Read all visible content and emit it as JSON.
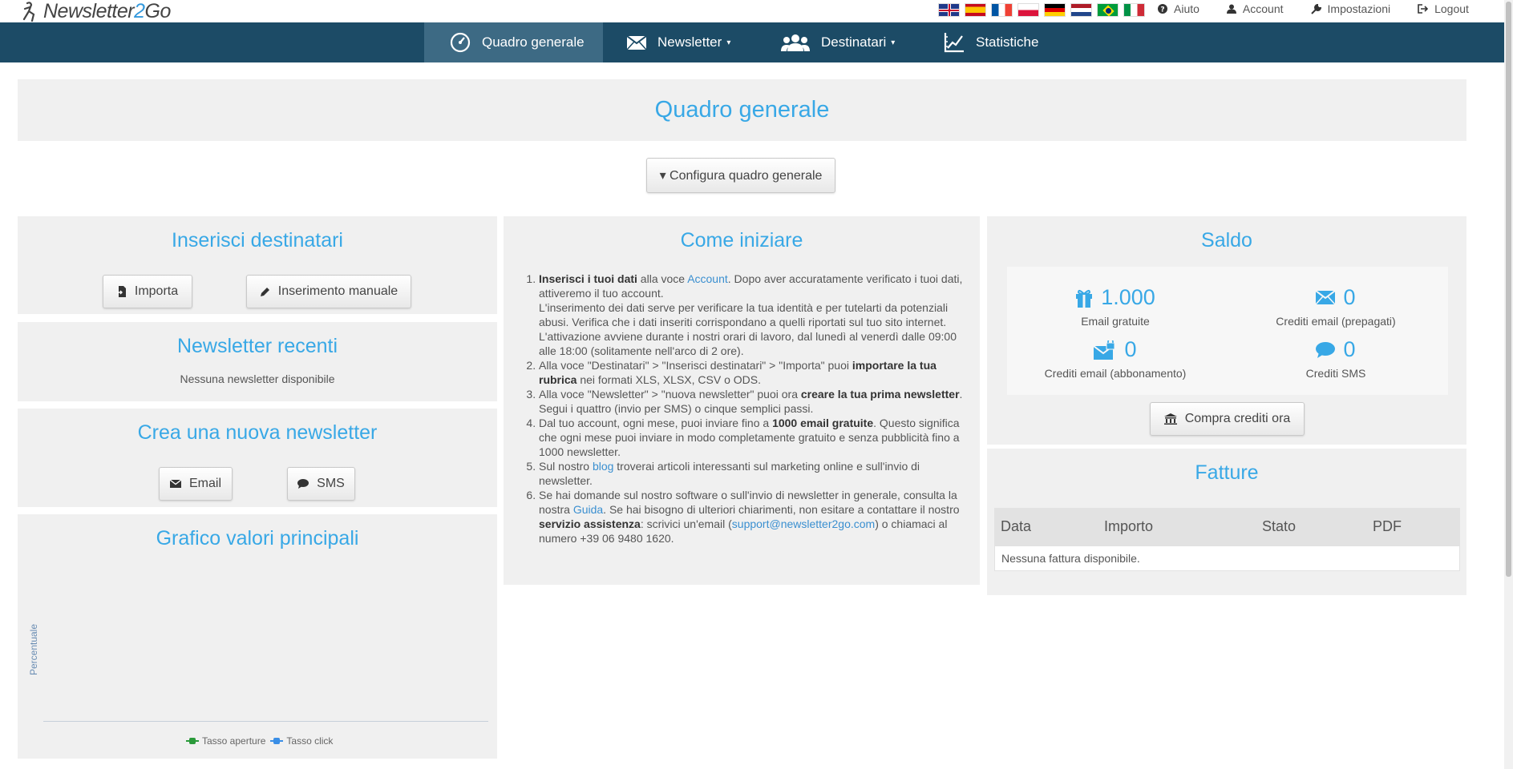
{
  "brand": {
    "name_part1": "Newsletter",
    "name_part2": "2",
    "name_part3": "Go"
  },
  "flags": [
    "flag-uk",
    "flag-spain",
    "flag-france",
    "flag-poland",
    "flag-germany",
    "flag-netherlands",
    "flag-brazil",
    "flag-italy"
  ],
  "toplinks": {
    "help": "Aiuto",
    "account": "Account",
    "settings": "Impostazioni",
    "logout": "Logout"
  },
  "nav": {
    "overview": "Quadro generale",
    "newsletter": "Newsletter",
    "recipients": "Destinatari",
    "stats": "Statistiche",
    "caret": "▾"
  },
  "page": {
    "title": "Quadro generale",
    "configure_button": "▾ Configura quadro generale"
  },
  "insert_recipients": {
    "title": "Inserisci destinatari",
    "import": "Importa",
    "manual": "Inserimento manuale"
  },
  "recent_newsletters": {
    "title": "Newsletter recenti",
    "empty": "Nessuna newsletter disponibile"
  },
  "create_newsletter": {
    "title": "Crea una nuova newsletter",
    "email": "Email",
    "sms": "SMS"
  },
  "chart": {
    "title": "Grafico valori principali",
    "ylabel": "Percentuale",
    "legend_open": "Tasso aperture",
    "legend_click": "Tasso click",
    "colors": {
      "open": "#2a9a3a",
      "click": "#3a8ee6"
    }
  },
  "chart_data": {
    "type": "line",
    "title": "Grafico valori principali",
    "ylabel": "Percentuale",
    "xlabel": "",
    "series": [
      {
        "name": "Tasso aperture",
        "values": []
      },
      {
        "name": "Tasso click",
        "values": []
      }
    ]
  },
  "getting_started": {
    "title": "Come iniziare",
    "s1_bold": "Inserisci i tuoi dati",
    "s1_a": " alla voce ",
    "s1_link": "Account",
    "s1_b": ". Dopo aver accuratamente verificato i tuoi dati, attiveremo il tuo account.",
    "s1_c": "L'inserimento dei dati serve per verificare la tua identità e per tutelarti da potenziali abusi. Verifica che i dati inseriti corrispondano a quelli riportati sul tuo sito internet.",
    "s1_d": "L'attivazione avviene durante i nostri orari di lavoro, dal lunedì al venerdì dalle 09:00 alle 18:00 (solitamente nell'arco di 2 ore).",
    "s2_a": "Alla voce \"Destinatari\" > \"Inserisci destinatari\" > \"Importa\" puoi ",
    "s2_bold": "importare la tua rubrica",
    "s2_b": " nei formati XLS, XLSX, CSV o ODS.",
    "s3_a": "Alla voce \"Newsletter\" > \"nuova newsletter\" puoi ora ",
    "s3_bold": "creare la tua prima newsletter",
    "s3_b": ". Segui i quattro (invio per SMS) o cinque semplici passi.",
    "s4_a": "Dal tuo account, ogni mese, puoi inviare fino a ",
    "s4_bold": "1000 email gratuite",
    "s4_b": ". Questo significa che ogni mese puoi inviare in modo completamente gratuito e senza pubblicità fino a 1000 newsletter.",
    "s5_a": "Sul nostro ",
    "s5_link": "blog",
    "s5_b": " troverai articoli interessanti sul marketing online e sull'invio di newsletter.",
    "s6_a": "Se hai domande sul nostro software o sull'invio di newsletter in generale, consulta la nostra ",
    "s6_link": "Guida",
    "s6_b": ". Se hai bisogno di ulteriori chiarimenti, non esitare a contattare il nostro ",
    "s6_bold": "servizio assistenza",
    "s6_c": ": scrivici un'email (",
    "s6_email": "support@newsletter2go.com",
    "s6_d": ") o chiamaci al numero +39 06 9480 1620."
  },
  "balance": {
    "title": "Saldo",
    "free_emails": {
      "value": "1.000",
      "label": "Email gratuite"
    },
    "prepaid": {
      "value": "0",
      "label": "Crediti email (prepagati)"
    },
    "subscription": {
      "value": "0",
      "label": "Crediti email (abbonamento)"
    },
    "sms": {
      "value": "0",
      "label": "Crediti SMS"
    },
    "buy": "Compra crediti ora"
  },
  "invoices": {
    "title": "Fatture",
    "columns": [
      "Data",
      "Importo",
      "Stato",
      "PDF"
    ],
    "empty": "Nessuna fattura disponibile."
  }
}
